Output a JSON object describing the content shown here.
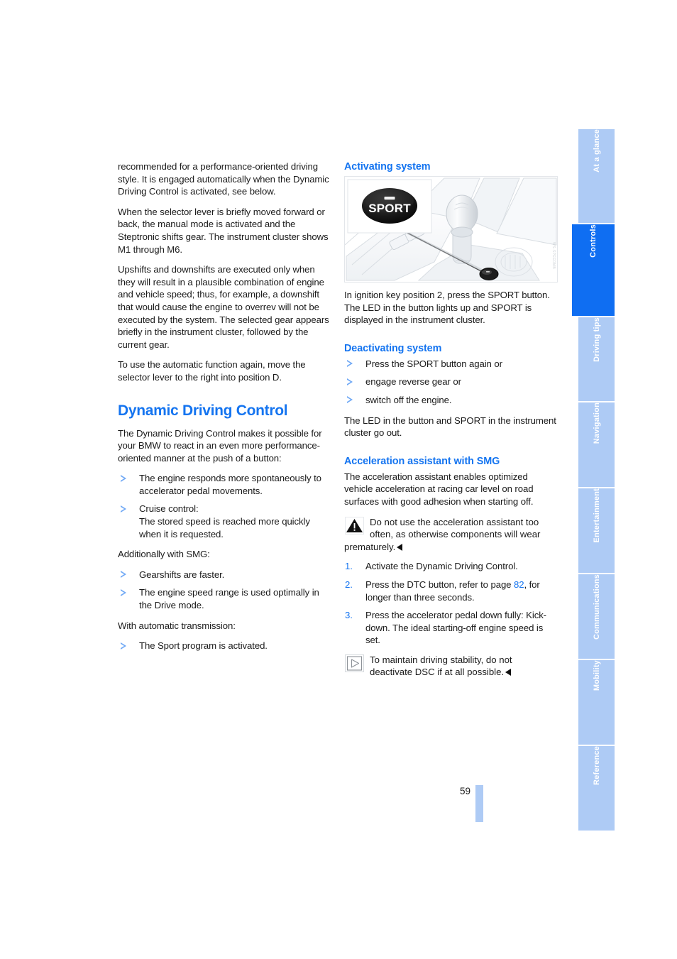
{
  "document": {
    "page_number": "59"
  },
  "left_column": {
    "paragraphs": [
      "recommended for a performance-oriented driving style. It is engaged automatically when the Dynamic Driving Control is activated, see below.",
      "When the selector lever is briefly moved forward or back, the manual mode is activated and the Steptronic shifts gear. The instrument cluster shows M1 through M6.",
      "Upshifts and downshifts are executed only when they will result in a plausible combination of engine and vehicle speed; thus, for example, a downshift that would cause the engine to overrev will not be executed by the system. The selected gear appears briefly in the instrument cluster, followed by the current gear.",
      "To use the automatic function again, move the selector lever to the right into position D."
    ],
    "section_title": "Dynamic Driving Control",
    "intro": "The Dynamic Driving Control makes it possible for your BMW to react in an even more performance-oriented manner at the push of a button:",
    "bullets_main": [
      "The engine responds more spontaneously to accelerator pedal movements.",
      "Cruise control:\nThe stored speed is reached more quickly when it is requested."
    ],
    "smg_lead": "Additionally with SMG:",
    "bullets_smg": [
      "Gearshifts are faster.",
      "The engine speed range is used optimally in the Drive mode."
    ],
    "auto_lead": "With automatic transmission:",
    "bullets_auto": [
      "The Sport program is activated."
    ]
  },
  "right_column": {
    "activating": {
      "heading": "Activating system",
      "figure": {
        "button_label": "SPORT",
        "code": "WS-SPEEDMB"
      },
      "body_1": "In ignition key position 2, press the SPORT button.",
      "body_2": "The LED in the button lights up and SPORT is displayed in the instrument cluster."
    },
    "deactivating": {
      "heading": "Deactivating system",
      "bullets": [
        "Press the SPORT button again or",
        "engage reverse gear or",
        "switch off the engine."
      ],
      "closing": "The LED in the button and SPORT in the instrument cluster go out."
    },
    "acceleration": {
      "heading": "Acceleration assistant with SMG",
      "intro": "The acceleration assistant enables optimized vehicle acceleration at racing car level on road surfaces with good adhesion when starting off.",
      "warning": "Do not use the acceleration assistant too often, as otherwise components will wear",
      "warning_tail": "prematurely.",
      "steps": [
        "Activate the Dynamic Driving Control.",
        "Press the DTC button, refer to page 82, for longer than three seconds.",
        "Press the accelerator pedal down fully: Kick-down. The ideal starting-off engine speed is set."
      ],
      "step2_pre": "Press the DTC button, refer to page ",
      "step2_link": "82",
      "step2_post": ", for longer than three seconds.",
      "note": "To maintain driving stability, do not deactivate DSC if at all possible."
    }
  },
  "sidebar": {
    "tabs": [
      {
        "label": "At a glance",
        "active": false
      },
      {
        "label": "Controls",
        "active": true
      },
      {
        "label": "Driving tips",
        "active": false
      },
      {
        "label": "Navigation",
        "active": false
      },
      {
        "label": "Entertainment",
        "active": false
      },
      {
        "label": "Communications",
        "active": false
      },
      {
        "label": "Mobility",
        "active": false
      },
      {
        "label": "Reference",
        "active": false
      }
    ]
  },
  "colors": {
    "heading_blue": "#1474f0",
    "tab_inactive": "#aecbf5",
    "tab_active": "#0f6ef2"
  }
}
